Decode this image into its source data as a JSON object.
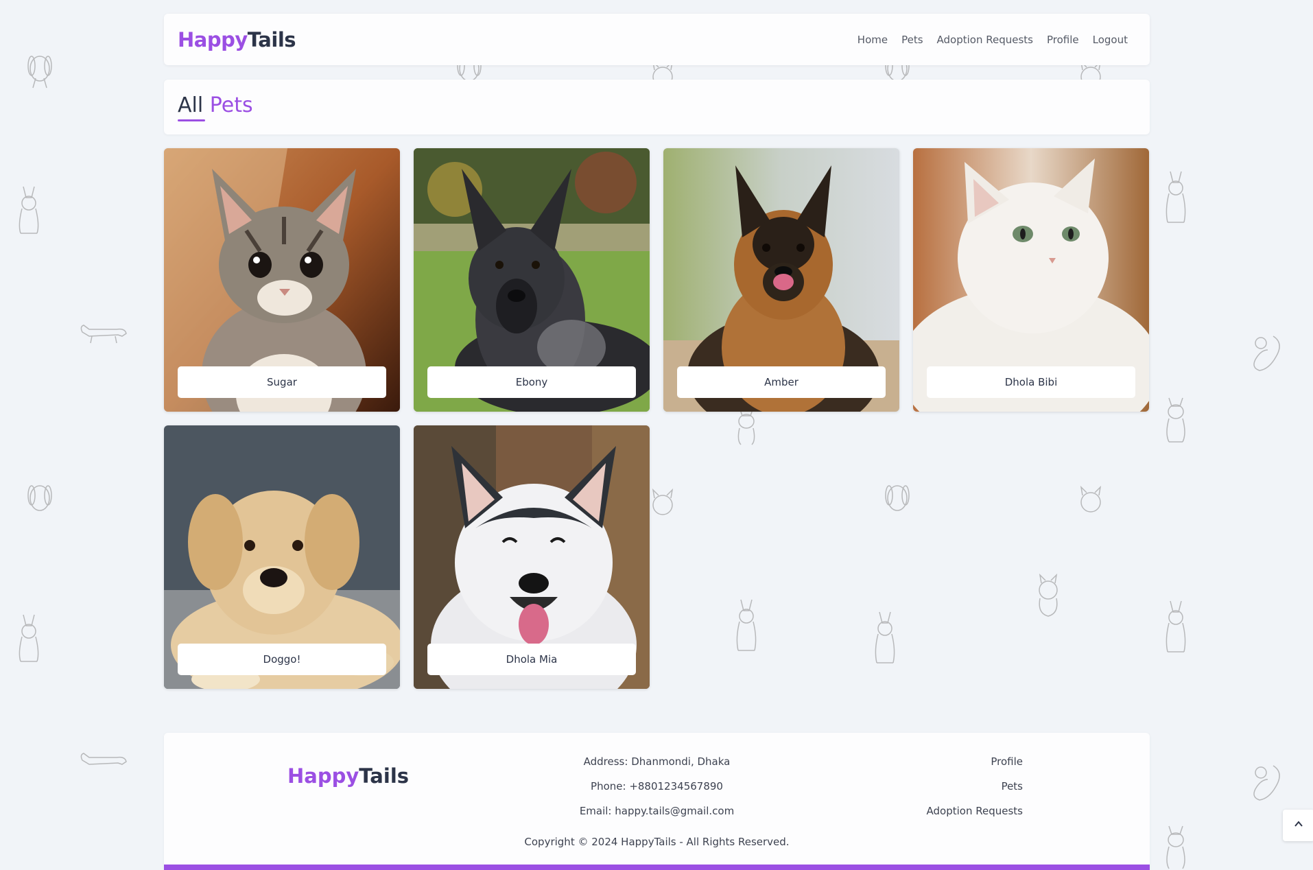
{
  "brand": {
    "part1": "Happy",
    "part2": "Tails"
  },
  "nav": {
    "items": [
      {
        "label": "Home"
      },
      {
        "label": "Pets"
      },
      {
        "label": "Adoption Requests"
      },
      {
        "label": "Profile"
      },
      {
        "label": "Logout"
      }
    ]
  },
  "page": {
    "title_part1": "All",
    "title_part2": "Pets"
  },
  "pets": [
    {
      "name": "Sugar",
      "animal": "cat"
    },
    {
      "name": "Ebony",
      "animal": "dog"
    },
    {
      "name": "Amber",
      "animal": "dog"
    },
    {
      "name": "Dhola Bibi",
      "animal": "cat"
    },
    {
      "name": "Doggo!",
      "animal": "dog"
    },
    {
      "name": "Dhola Mia",
      "animal": "dog"
    }
  ],
  "footer": {
    "address": "Address: Dhanmondi, Dhaka",
    "phone": "Phone: +8801234567890",
    "email": "Email: happy.tails@gmail.com",
    "links": [
      {
        "label": "Profile"
      },
      {
        "label": "Pets"
      },
      {
        "label": "Adoption Requests"
      }
    ],
    "copyright": "Copyright © 2024 HappyTails - All Rights Reserved."
  },
  "icons": {
    "scroll_top": "chevron-up-icon",
    "background": "pet-doodle-icon"
  },
  "colors": {
    "accent": "#9b4fe3",
    "dark": "#2c3448",
    "background": "#f1f4f8"
  }
}
